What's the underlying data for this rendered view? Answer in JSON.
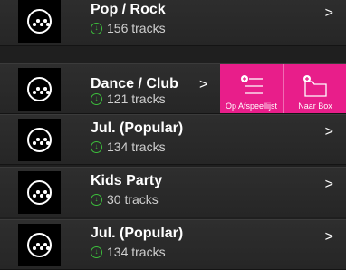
{
  "rows": [
    {
      "title": "Pop / Rock",
      "tracks": "156 tracks",
      "chevron": ">"
    },
    {
      "title": "Dance / Club",
      "tracks": "121 tracks",
      "chevron": ">"
    },
    {
      "title": "Jul. (Popular)",
      "tracks": "134 tracks",
      "chevron": ">"
    },
    {
      "title": "Kids Party",
      "tracks": "30 tracks",
      "chevron": ">"
    },
    {
      "title": "Jul. (Popular)",
      "tracks": "134 tracks",
      "chevron": ">"
    }
  ],
  "actions": {
    "add_to_playlist": "Op Afspeellijst",
    "to_box": "Naar Box"
  },
  "colors": {
    "accent": "#e81e8a",
    "downloaded": "#3cbf3c",
    "background": "#1f1f1f"
  },
  "icons": {
    "artwork": "music-logo-icon",
    "downloaded": "download-check-icon",
    "chevron": "chevron-right-icon",
    "playlist": "add-to-playlist-icon",
    "box": "add-to-box-icon"
  }
}
